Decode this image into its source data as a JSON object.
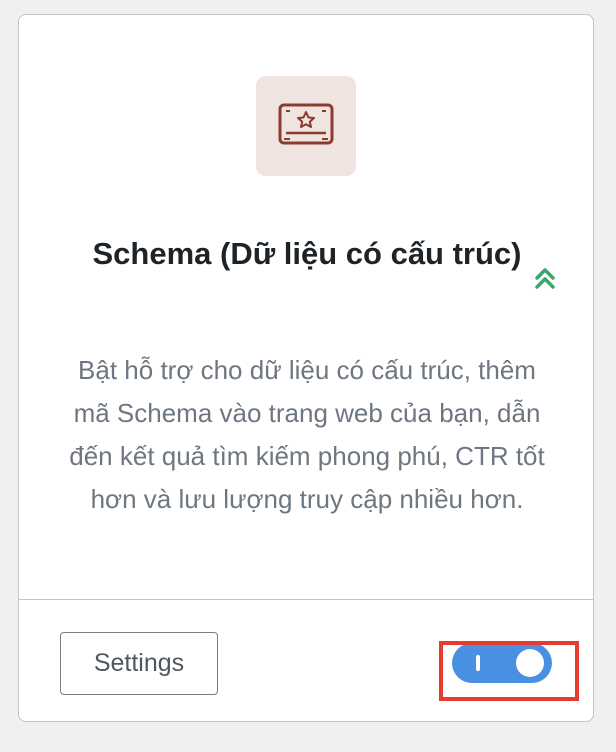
{
  "module": {
    "icon": "certificate-icon",
    "title": "Schema (Dữ liệu có cấu trúc)",
    "badge_icon": "double-chevron-up-icon",
    "description": "Bật hỗ trợ cho dữ liệu có cấu trúc, thêm mã Schema vào trang web của bạn, dẫn đến kết quả tìm kiếm phong phú, CTR tốt hơn và lưu lượng truy cập nhiều hơn.",
    "settings_label": "Settings",
    "toggle_on": true
  },
  "colors": {
    "icon": "#8c3b2f",
    "icon_bg": "#efe4e0",
    "badge": "#3aa76d",
    "toggle": "#4a90e2",
    "highlight": "#e53c2e"
  }
}
